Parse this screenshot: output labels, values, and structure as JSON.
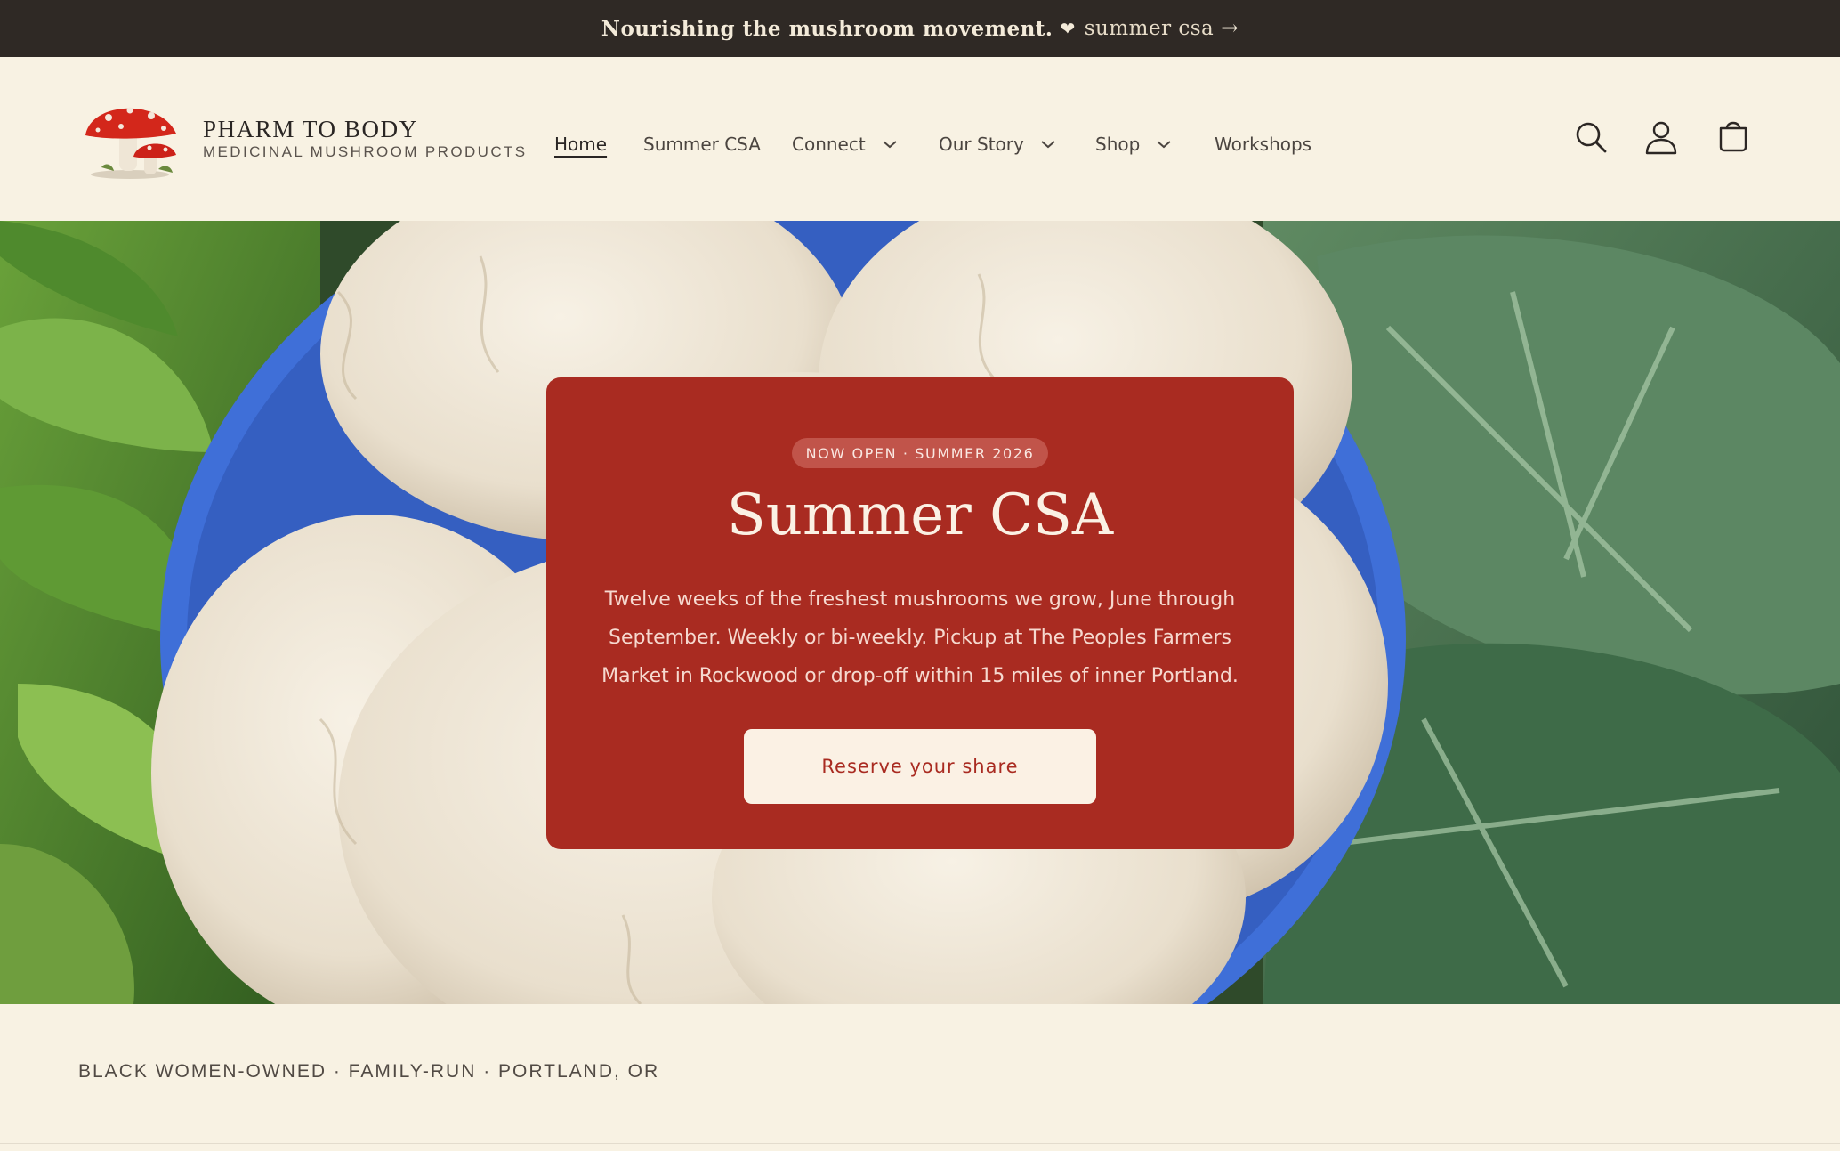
{
  "announcement": {
    "lead": "Nourishing the mushroom movement.",
    "heart_icon": "heart-icon",
    "link_label": "summer csa",
    "arrow": "→"
  },
  "brand": {
    "name": "PHARM TO BODY",
    "tagline": "MEDICINAL MUSHROOM PRODUCTS",
    "logo_icon": "red-mushroom-logo"
  },
  "nav": {
    "items": [
      {
        "label": "Home",
        "active": true
      },
      {
        "label": "Summer CSA",
        "active": false
      },
      {
        "label": "Connect",
        "dropdown": true
      },
      {
        "label": "Our Story",
        "dropdown": true
      },
      {
        "label": "Shop",
        "dropdown": true
      },
      {
        "label": "Workshops",
        "active": false
      }
    ]
  },
  "header_icons": [
    "search-icon",
    "account-icon",
    "cart-icon"
  ],
  "hero": {
    "image": "lions-mane-mushrooms-in-blue-bowl",
    "badge": "NOW OPEN · SUMMER 2026",
    "title": "Summer CSA",
    "body": "Twelve weeks of the freshest mushrooms we grow, June through September. Weekly or bi-weekly. Pickup at The Peoples Farmers Market in Rockwood or drop-off within 15 miles of inner Portland.",
    "cta_label": "Reserve your share"
  },
  "strip": {
    "text": "BLACK WOMEN-OWNED · FAMILY-RUN · PORTLAND, OR"
  },
  "colors": {
    "announcement_bg": "#2f2925",
    "page_bg": "#f8f2e3",
    "card_bg": "#a92b21",
    "cta_bg": "#fbf1e4"
  }
}
